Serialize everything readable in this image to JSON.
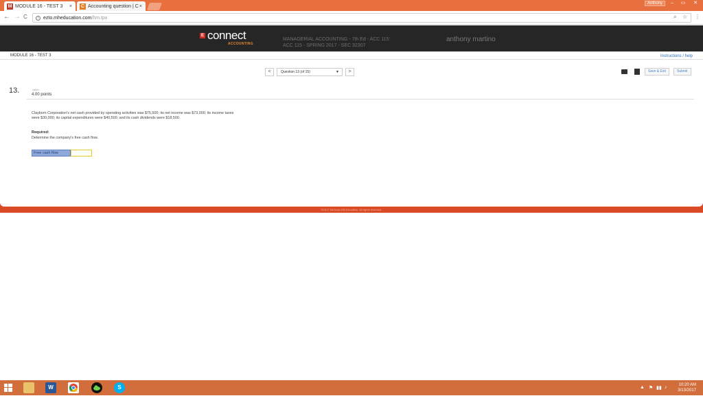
{
  "browser": {
    "tabs": [
      {
        "favicon": "M",
        "title": "MODULE 16 - TEST 3",
        "close": "×"
      },
      {
        "favicon": "C",
        "title": "Accounting question | C",
        "close": "×"
      }
    ],
    "user_badge": "Anthony",
    "window_buttons": {
      "minimize": "–",
      "maximize": "▭",
      "close": "✕"
    },
    "url_host": "ezto.mheducation.com",
    "url_path": "/hm.tpx",
    "nav": {
      "back": "←",
      "forward": "→",
      "reload": "C"
    },
    "omni_icons": {
      "zoom": "⌕",
      "star": "☆",
      "menu": "⋮"
    }
  },
  "header": {
    "logo_mark": "E",
    "logo_text": "connect",
    "logo_sub": "ACCOUNTING",
    "course_line1": "MANAGERIAL ACCOUNTING - 7th Ed - ACC 115:",
    "course_line2": "ACC 115 - SPRING 2017 - SEC 32307",
    "student_name": "anthony martino"
  },
  "module": {
    "title": "MODULE 16 - TEST 3",
    "instructions": "Instructions / help"
  },
  "question_nav": {
    "prev": "<",
    "next": ">",
    "selected": "Question 13 (of 15)",
    "caret": "▼",
    "save_exit": "Save & Exit",
    "submit": "Submit"
  },
  "question": {
    "number": "13.",
    "value_label": "value:",
    "points": "4.00 points",
    "text": "Clayborn Corporation's net cash provided by operating activities was $75,500; its net income was $73,000; its income taxes were $30,000; its capital expenditures were $40,500; and its cash dividends were $18,500.",
    "required_heading": "Required:",
    "required_text": "Determine the company's free cash flow.",
    "answer_label": "Free cash flow",
    "answer_value": ""
  },
  "footer": {
    "copyright": "©2017 McGraw-Hill Education. All rights reserved."
  },
  "taskbar": {
    "clock_time": "10:20 AM",
    "clock_date": "3/13/2017",
    "tray_icons": [
      "▲",
      "⚑",
      "▮▮",
      "♪"
    ]
  },
  "colors": {
    "chrome_orange": "#e8703f",
    "connect_dark": "#262626",
    "accent_red": "#d94a25",
    "taskbar": "#d26d3c",
    "link_blue": "#2a6fbf"
  }
}
